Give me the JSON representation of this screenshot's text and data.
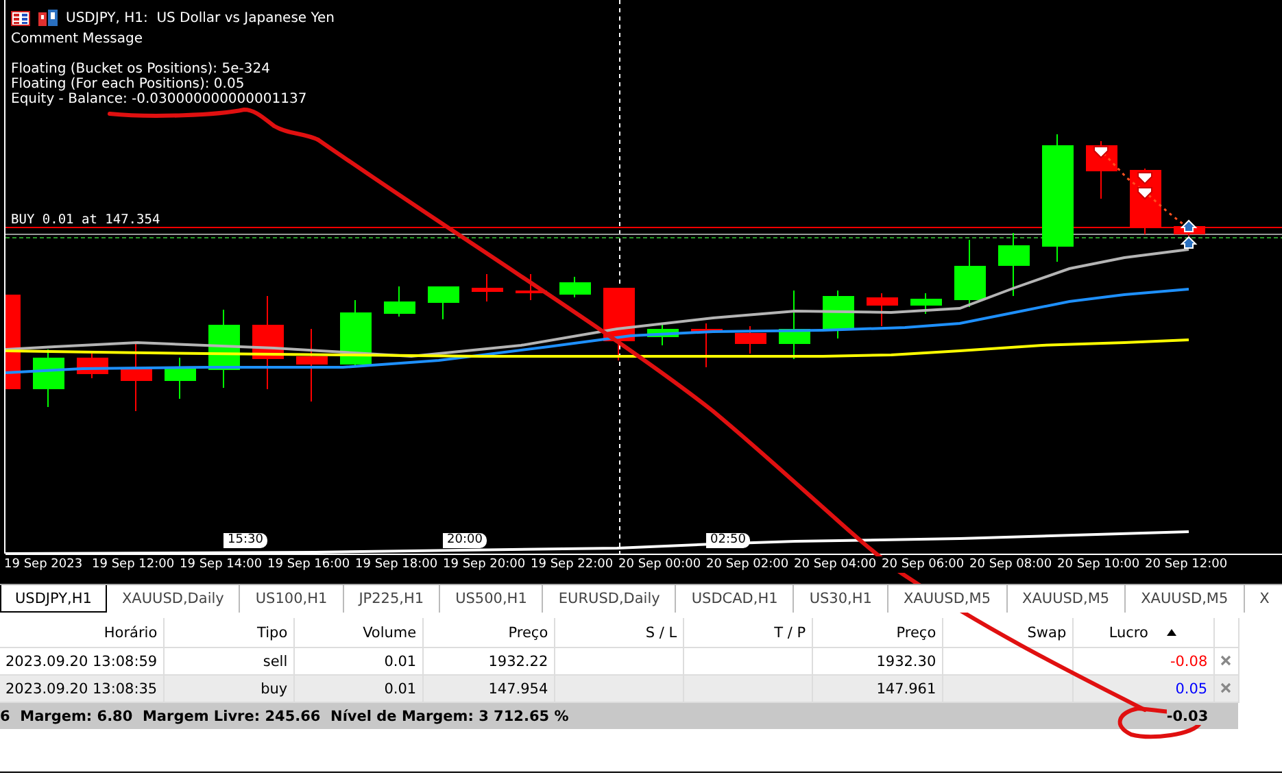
{
  "window": {
    "title": "USDJPY, H1:  US Dollar vs Japanese Yen"
  },
  "chart": {
    "comment": "Comment Message",
    "info_lines": [
      "Floating (Bucket os Positions): 5e-324",
      "Floating (For each Positions): 0.05",
      "Equity - Balance: -0.030000000000001137"
    ],
    "order_label": "BUY 0.01 at 147.354",
    "time_markers": [
      "15:30",
      "20:00",
      "02:50"
    ],
    "time_axis": [
      "19 Sep 2023",
      "19 Sep 12:00",
      "19 Sep 14:00",
      "19 Sep 16:00",
      "19 Sep 18:00",
      "19 Sep 20:00",
      "19 Sep 22:00",
      "20 Sep 00:00",
      "20 Sep 02:00",
      "20 Sep 04:00",
      "20 Sep 06:00",
      "20 Sep 08:00",
      "20 Sep 10:00",
      "20 Sep 12:00"
    ]
  },
  "tabs": [
    {
      "label": "USDJPY,H1",
      "selected": true
    },
    {
      "label": "XAUUSD,Daily",
      "selected": false
    },
    {
      "label": "US100,H1",
      "selected": false
    },
    {
      "label": "JP225,H1",
      "selected": false
    },
    {
      "label": "US500,H1",
      "selected": false
    },
    {
      "label": "EURUSD,Daily",
      "selected": false
    },
    {
      "label": "USDCAD,H1",
      "selected": false
    },
    {
      "label": "US30,H1",
      "selected": false
    },
    {
      "label": "XAUUSD,M5",
      "selected": false
    },
    {
      "label": "XAUUSD,M5",
      "selected": false
    },
    {
      "label": "XAUUSD,M5",
      "selected": false
    },
    {
      "label": "X",
      "selected": false
    }
  ],
  "table": {
    "columns": [
      {
        "label": "Horário",
        "sorted": false
      },
      {
        "label": "Tipo",
        "sorted": false
      },
      {
        "label": "Volume",
        "sorted": false
      },
      {
        "label": "Preço",
        "sorted": false
      },
      {
        "label": "S / L",
        "sorted": false
      },
      {
        "label": "T / P",
        "sorted": false
      },
      {
        "label": "Preço",
        "sorted": false
      },
      {
        "label": "Swap",
        "sorted": false
      },
      {
        "label": "Lucro",
        "sorted": true
      }
    ],
    "rows": [
      {
        "cells": [
          "2023.09.20 13:08:59",
          "sell",
          "0.01",
          "1932.22",
          "",
          "",
          "1932.30",
          "",
          "-0.08"
        ],
        "kind": "loss"
      },
      {
        "cells": [
          "2023.09.20 13:08:35",
          "buy",
          "0.01",
          "147.954",
          "",
          "",
          "147.961",
          "",
          "0.05"
        ],
        "kind": "profit"
      }
    ],
    "summary": {
      "text": "6  Margem: 6.80  Margem Livre: 245.66  Nível de Margem: 3 712.65 %",
      "total": "-0.03"
    }
  }
}
